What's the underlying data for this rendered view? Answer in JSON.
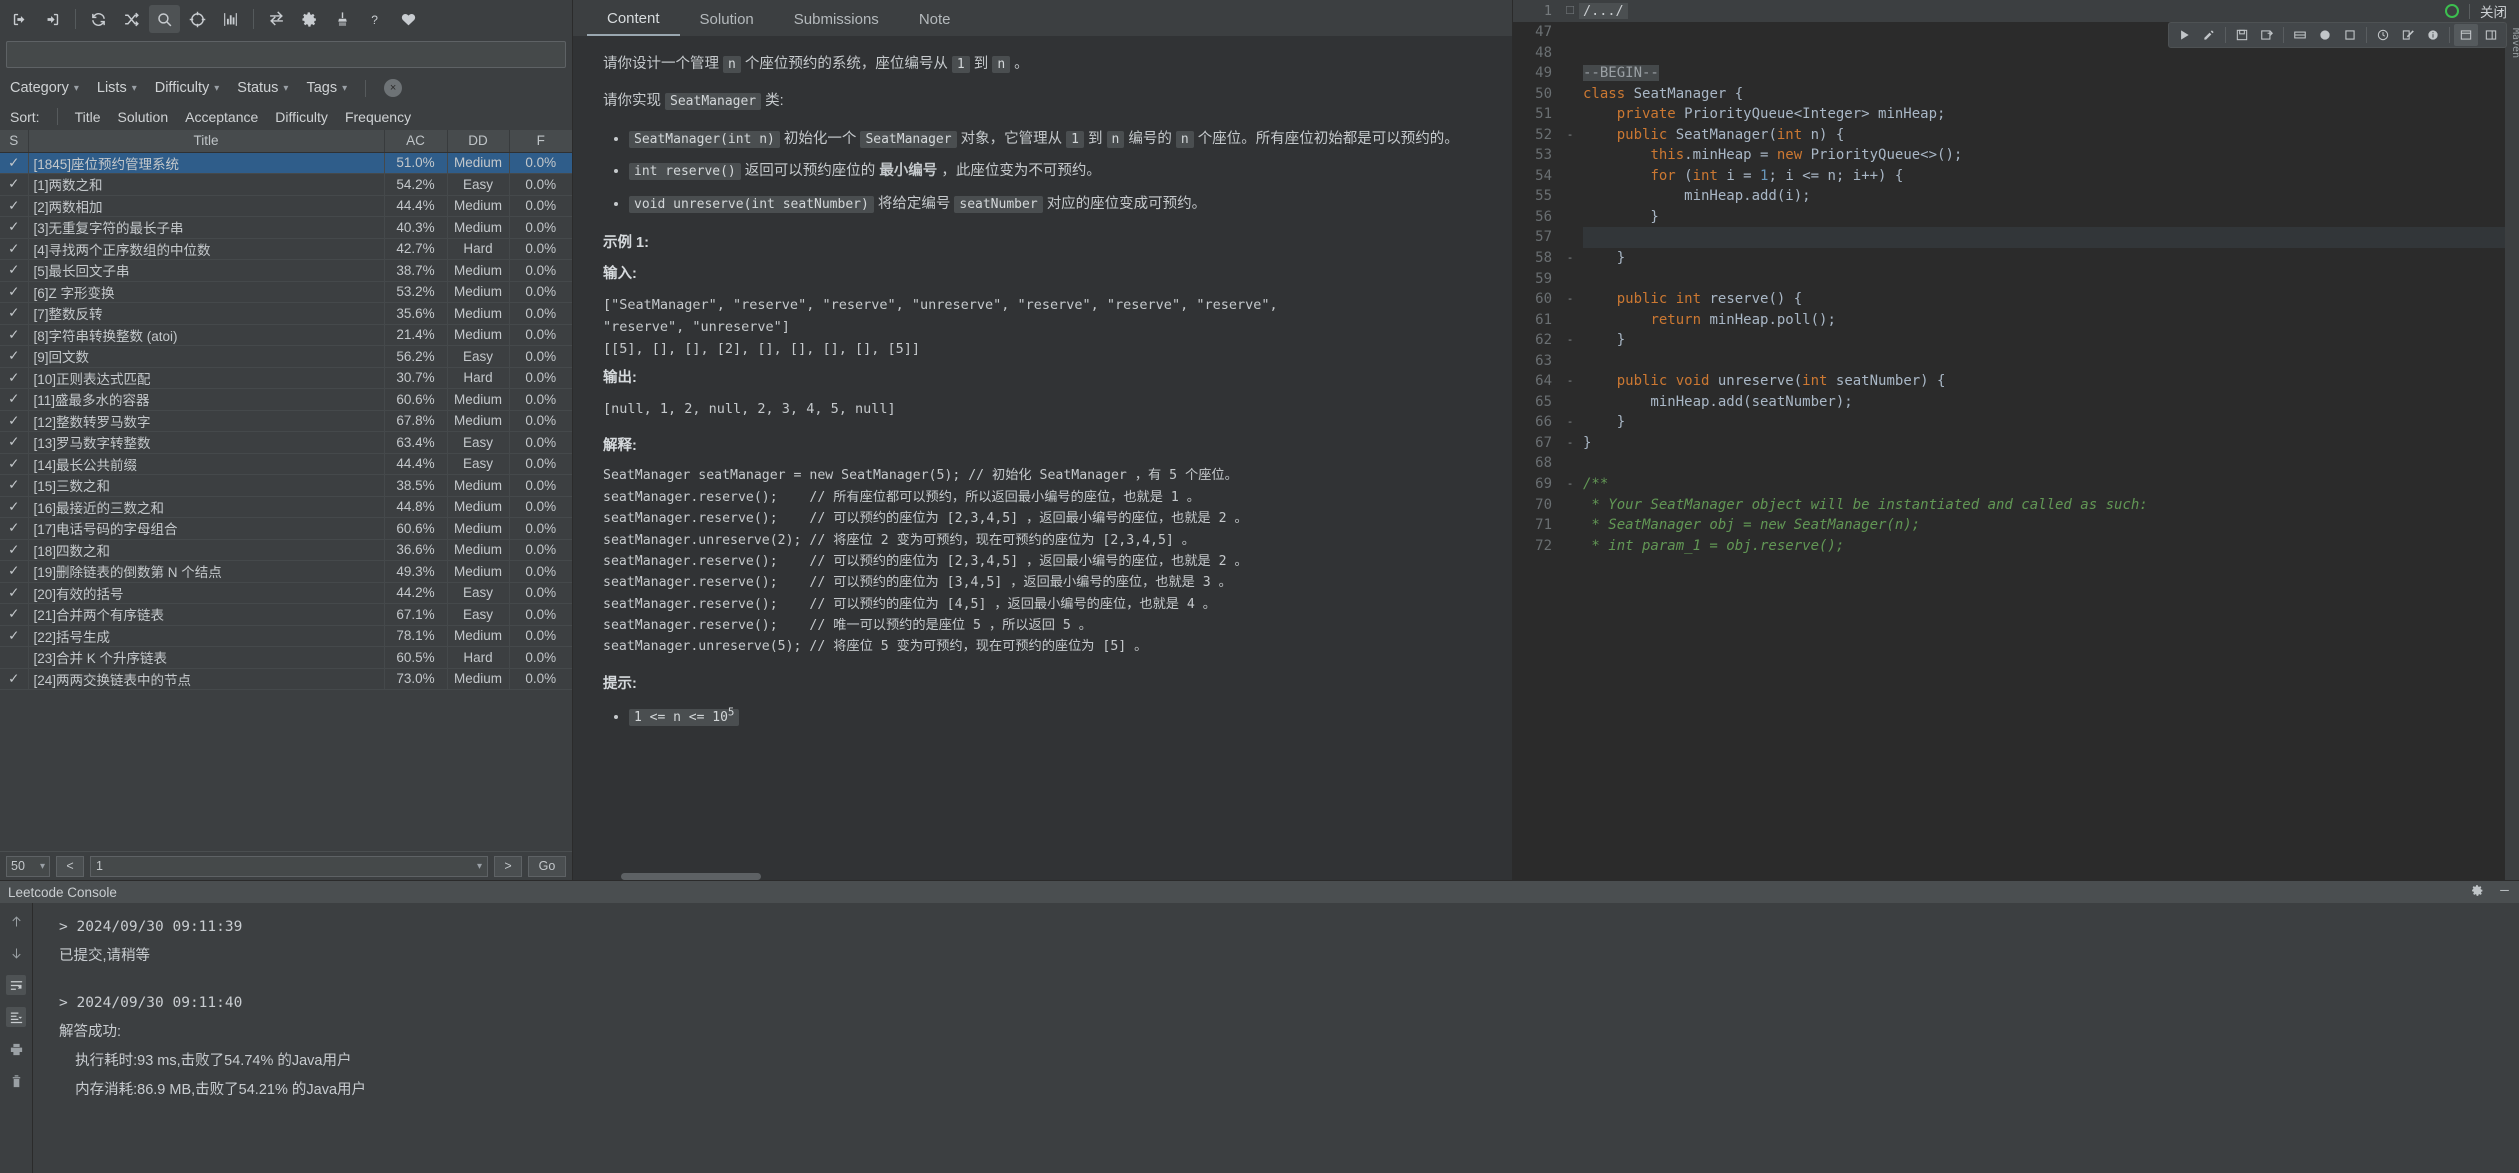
{
  "left_toolbar": {
    "buttons": [
      {
        "name": "sign-in-icon",
        "label": "Sign In"
      },
      {
        "name": "sign-out-icon",
        "label": "Sign Out"
      },
      {
        "name": "refresh-icon",
        "label": "Refresh"
      },
      {
        "name": "shuffle-icon",
        "label": "Random"
      },
      {
        "name": "search-icon",
        "label": "Search",
        "active": true
      },
      {
        "name": "target-icon",
        "label": "Locate"
      },
      {
        "name": "chart-bar-icon",
        "label": "Statistics"
      },
      {
        "name": "swap-icon",
        "label": "Switch"
      },
      {
        "name": "gear-icon",
        "label": "Settings"
      },
      {
        "name": "broom-icon",
        "label": "Clean"
      },
      {
        "name": "help-icon",
        "label": "Help"
      },
      {
        "name": "heart-icon",
        "label": "Favorite"
      }
    ]
  },
  "search": {
    "value": "",
    "placeholder": ""
  },
  "filters": [
    {
      "name": "category",
      "label": "Category"
    },
    {
      "name": "lists",
      "label": "Lists"
    },
    {
      "name": "difficulty",
      "label": "Difficulty"
    },
    {
      "name": "status",
      "label": "Status"
    },
    {
      "name": "tags",
      "label": "Tags"
    }
  ],
  "filter_clear_label": "×",
  "sort": {
    "label": "Sort:",
    "options": [
      "Title",
      "Solution",
      "Acceptance",
      "Difficulty",
      "Frequency"
    ]
  },
  "table": {
    "columns": [
      "S",
      "Title",
      "AC",
      "DD",
      "F"
    ],
    "rows": [
      {
        "s": "✓",
        "title": "[1845]座位预约管理系统",
        "ac": "51.0%",
        "dd": "Medium",
        "f": "0.0%",
        "selected": true
      },
      {
        "s": "✓",
        "title": "[1]两数之和",
        "ac": "54.2%",
        "dd": "Easy",
        "f": "0.0%"
      },
      {
        "s": "✓",
        "title": "[2]两数相加",
        "ac": "44.4%",
        "dd": "Medium",
        "f": "0.0%"
      },
      {
        "s": "✓",
        "title": "[3]无重复字符的最长子串",
        "ac": "40.3%",
        "dd": "Medium",
        "f": "0.0%"
      },
      {
        "s": "✓",
        "title": "[4]寻找两个正序数组的中位数",
        "ac": "42.7%",
        "dd": "Hard",
        "f": "0.0%"
      },
      {
        "s": "✓",
        "title": "[5]最长回文子串",
        "ac": "38.7%",
        "dd": "Medium",
        "f": "0.0%"
      },
      {
        "s": "✓",
        "title": "[6]Z 字形变换",
        "ac": "53.2%",
        "dd": "Medium",
        "f": "0.0%"
      },
      {
        "s": "✓",
        "title": "[7]整数反转",
        "ac": "35.6%",
        "dd": "Medium",
        "f": "0.0%"
      },
      {
        "s": "✓",
        "title": "[8]字符串转换整数 (atoi)",
        "ac": "21.4%",
        "dd": "Medium",
        "f": "0.0%"
      },
      {
        "s": "✓",
        "title": "[9]回文数",
        "ac": "56.2%",
        "dd": "Easy",
        "f": "0.0%"
      },
      {
        "s": "✓",
        "title": "[10]正则表达式匹配",
        "ac": "30.7%",
        "dd": "Hard",
        "f": "0.0%"
      },
      {
        "s": "✓",
        "title": "[11]盛最多水的容器",
        "ac": "60.6%",
        "dd": "Medium",
        "f": "0.0%"
      },
      {
        "s": "✓",
        "title": "[12]整数转罗马数字",
        "ac": "67.8%",
        "dd": "Medium",
        "f": "0.0%"
      },
      {
        "s": "✓",
        "title": "[13]罗马数字转整数",
        "ac": "63.4%",
        "dd": "Easy",
        "f": "0.0%"
      },
      {
        "s": "✓",
        "title": "[14]最长公共前缀",
        "ac": "44.4%",
        "dd": "Easy",
        "f": "0.0%"
      },
      {
        "s": "✓",
        "title": "[15]三数之和",
        "ac": "38.5%",
        "dd": "Medium",
        "f": "0.0%"
      },
      {
        "s": "✓",
        "title": "[16]最接近的三数之和",
        "ac": "44.8%",
        "dd": "Medium",
        "f": "0.0%"
      },
      {
        "s": "✓",
        "title": "[17]电话号码的字母组合",
        "ac": "60.6%",
        "dd": "Medium",
        "f": "0.0%"
      },
      {
        "s": "✓",
        "title": "[18]四数之和",
        "ac": "36.6%",
        "dd": "Medium",
        "f": "0.0%"
      },
      {
        "s": "✓",
        "title": "[19]删除链表的倒数第 N 个结点",
        "ac": "49.3%",
        "dd": "Medium",
        "f": "0.0%"
      },
      {
        "s": "✓",
        "title": "[20]有效的括号",
        "ac": "44.2%",
        "dd": "Easy",
        "f": "0.0%"
      },
      {
        "s": "✓",
        "title": "[21]合并两个有序链表",
        "ac": "67.1%",
        "dd": "Easy",
        "f": "0.0%"
      },
      {
        "s": "✓",
        "title": "[22]括号生成",
        "ac": "78.1%",
        "dd": "Medium",
        "f": "0.0%"
      },
      {
        "s": "",
        "title": "[23]合并 K 个升序链表",
        "ac": "60.5%",
        "dd": "Hard",
        "f": "0.0%"
      },
      {
        "s": "✓",
        "title": "[24]两两交换链表中的节点",
        "ac": "73.0%",
        "dd": "Medium",
        "f": "0.0%"
      }
    ]
  },
  "pager": {
    "page_size": "50",
    "prev_label": "<",
    "page_value": "1",
    "next_label": ">",
    "go_label": "Go"
  },
  "tabs": [
    {
      "name": "content",
      "label": "Content",
      "active": true
    },
    {
      "name": "solution",
      "label": "Solution",
      "active": false
    },
    {
      "name": "submissions",
      "label": "Submissions",
      "active": false
    },
    {
      "name": "note",
      "label": "Note",
      "active": false
    }
  ],
  "problem": {
    "intro_a": "请你设计一个管理",
    "intro_n1": "n",
    "intro_b": "个座位预约的系统，座位编号从",
    "intro_n2": "1",
    "intro_c": "到",
    "intro_n3": "n",
    "intro_d": "。",
    "impl_a": "请你实现",
    "impl_code": "SeatManager",
    "impl_b": "类:",
    "bullets": [
      {
        "code": "SeatManager(int n)",
        "t1": "初始化一个",
        "code2": "SeatManager",
        "t2": "对象，它管理从",
        "code3": "1",
        "t3": "到",
        "code4": "n",
        "t4": "编号的",
        "code5": "n",
        "t5": "个座位。所有座位初始都是可以预约的。"
      },
      {
        "code": "int reserve()",
        "t1": "返回可以预约座位的",
        "bold": "最小编号",
        "t2": "，此座位变为不可预约。"
      },
      {
        "code": "void unreserve(int seatNumber)",
        "t1": "将给定编号",
        "code2": "seatNumber",
        "t2": "对应的座位变成可预约。"
      }
    ],
    "example_title": "示例 1:",
    "input_label": "输入:",
    "input_line1": "[\"SeatManager\", \"reserve\", \"reserve\", \"unreserve\", \"reserve\", \"reserve\", \"reserve\",",
    "input_line2": "\"reserve\", \"unreserve\"]",
    "input_line3": "[[5], [], [], [2], [], [], [], [], [5]]",
    "output_label": "输出:",
    "output_line": "[null, 1, 2, null, 2, 3, 4, 5, null]",
    "explain_label": "解释:",
    "explain_lines": [
      "SeatManager seatManager = new SeatManager(5); // 初始化 SeatManager ，有 5 个座位。",
      "seatManager.reserve();    // 所有座位都可以预约，所以返回最小编号的座位，也就是 1 。",
      "seatManager.reserve();    // 可以预约的座位为 [2,3,4,5] ，返回最小编号的座位，也就是 2 。",
      "seatManager.unreserve(2); // 将座位 2 变为可预约，现在可预约的座位为 [2,3,4,5] 。",
      "seatManager.reserve();    // 可以预约的座位为 [2,3,4,5] ，返回最小编号的座位，也就是 2 。",
      "seatManager.reserve();    // 可以预约的座位为 [3,4,5] ，返回最小编号的座位，也就是 3 。",
      "seatManager.reserve();    // 可以预约的座位为 [4,5] ，返回最小编号的座位，也就是 4 。",
      "seatManager.reserve();    // 唯一可以预约的是座位 5 ，所以返回 5 。",
      "seatManager.unreserve(5); // 将座位 5 变为可预约，现在可预约的座位为 [5] 。"
    ],
    "hint_label": "提示:",
    "hint_1_a": "1 <= n <= 10",
    "hint_1_sup": "5"
  },
  "editor": {
    "path": "/.../",
    "close_label": "关闭",
    "first_line_number": "1",
    "vertical_tab": "Maven",
    "toolbar_icons": [
      {
        "name": "run-icon"
      },
      {
        "name": "edit-run-config-icon"
      },
      {
        "name": "save-icon"
      },
      {
        "name": "save-as-icon"
      },
      {
        "name": "submit-icon"
      },
      {
        "name": "globe-icon"
      },
      {
        "name": "stop-icon"
      },
      {
        "name": "clock-icon"
      },
      {
        "name": "note-edit-icon"
      },
      {
        "name": "info-icon"
      },
      {
        "name": "panel-icon",
        "selected": true
      },
      {
        "name": "panel-right-icon"
      }
    ],
    "lines": [
      {
        "n": "47",
        "code": "",
        "fold": ""
      },
      {
        "n": "48",
        "code": "",
        "fold": ""
      },
      {
        "n": "49",
        "code": "--BEGIN--",
        "type": "begin",
        "fold": ""
      },
      {
        "n": "50",
        "code": "class SeatManager {",
        "type": "class",
        "fold": ""
      },
      {
        "n": "51",
        "code": "    private PriorityQueue<Integer> minHeap;",
        "type": "field",
        "fold": ""
      },
      {
        "n": "52",
        "code": "    public SeatManager(int n) {",
        "type": "ctor",
        "fold": "-"
      },
      {
        "n": "53",
        "code": "        this.minHeap = new PriorityQueue<>();",
        "type": "plain",
        "fold": ""
      },
      {
        "n": "54",
        "code": "        for (int i = 1; i <= n; i++) {",
        "type": "for",
        "fold": ""
      },
      {
        "n": "55",
        "code": "            minHeap.add(i);",
        "type": "plain",
        "fold": ""
      },
      {
        "n": "56",
        "code": "        }",
        "type": "plain",
        "fold": ""
      },
      {
        "n": "57",
        "code": "",
        "type": "plain",
        "fold": "",
        "highlight": true
      },
      {
        "n": "58",
        "code": "    }",
        "type": "plain",
        "fold": "-"
      },
      {
        "n": "59",
        "code": "",
        "type": "plain",
        "fold": ""
      },
      {
        "n": "60",
        "code": "    public int reserve() {",
        "type": "m1",
        "fold": "-"
      },
      {
        "n": "61",
        "code": "        return minHeap.poll();",
        "type": "ret",
        "fold": ""
      },
      {
        "n": "62",
        "code": "    }",
        "type": "plain",
        "fold": "-"
      },
      {
        "n": "63",
        "code": "",
        "type": "plain",
        "fold": ""
      },
      {
        "n": "64",
        "code": "    public void unreserve(int seatNumber) {",
        "type": "m2",
        "fold": "-"
      },
      {
        "n": "65",
        "code": "        minHeap.add(seatNumber);",
        "type": "plain",
        "fold": ""
      },
      {
        "n": "66",
        "code": "    }",
        "type": "plain",
        "fold": "-"
      },
      {
        "n": "67",
        "code": "}",
        "type": "plain",
        "fold": "-"
      },
      {
        "n": "68",
        "code": "",
        "type": "plain",
        "fold": ""
      },
      {
        "n": "69",
        "code": "/**",
        "type": "comment",
        "fold": "-"
      },
      {
        "n": "70",
        "code": " * Your SeatManager object will be instantiated and called as such:",
        "type": "comment",
        "fold": ""
      },
      {
        "n": "71",
        "code": " * SeatManager obj = new SeatManager(n);",
        "type": "comment",
        "fold": ""
      },
      {
        "n": "72",
        "code": " * int param_1 = obj.reserve();",
        "type": "comment",
        "fold": ""
      }
    ]
  },
  "console": {
    "title": "Leetcode Console",
    "settings_icon": "gear-icon",
    "minimize_icon": "minimize-icon",
    "side_icons": [
      {
        "name": "scroll-up-icon"
      },
      {
        "name": "scroll-down-icon"
      },
      {
        "name": "soft-wrap-icon",
        "on": true
      },
      {
        "name": "scroll-to-end-icon",
        "on": true
      },
      {
        "name": "print-icon"
      },
      {
        "name": "trash-icon"
      }
    ],
    "entries": [
      {
        "prompt": "> 2024/09/30 09:11:39",
        "lines": [
          "已提交,请稍等"
        ]
      },
      {
        "prompt": "> 2024/09/30 09:11:40",
        "lines": [
          "解答成功:",
          "    执行耗时:93 ms,击败了54.74% 的Java用户",
          "    内存消耗:86.9 MB,击败了54.21% 的Java用户"
        ]
      }
    ]
  },
  "colors": {
    "easy": "#62b36b",
    "medium": "#e0a03a",
    "hard": "#e06c5a",
    "accent": "#cc7832"
  }
}
